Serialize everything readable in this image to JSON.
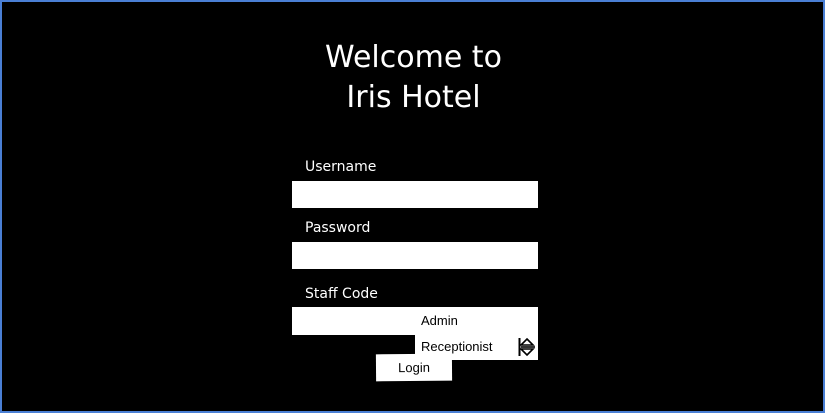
{
  "header": {
    "title_line1": "Welcome to",
    "title_line2": "Iris Hotel"
  },
  "form": {
    "username_label": "Username",
    "username_value": "",
    "password_label": "Password",
    "password_value": "",
    "staff_code_label": "Staff Code",
    "staff_code_options": [
      "Admin",
      "Receptionist"
    ],
    "login_label": "Login"
  },
  "colors": {
    "background": "#000000",
    "window_border": "#4a7fd4",
    "field_fill": "#ffffff"
  },
  "icons": {
    "spinner": "up-down-stepper-icon"
  }
}
